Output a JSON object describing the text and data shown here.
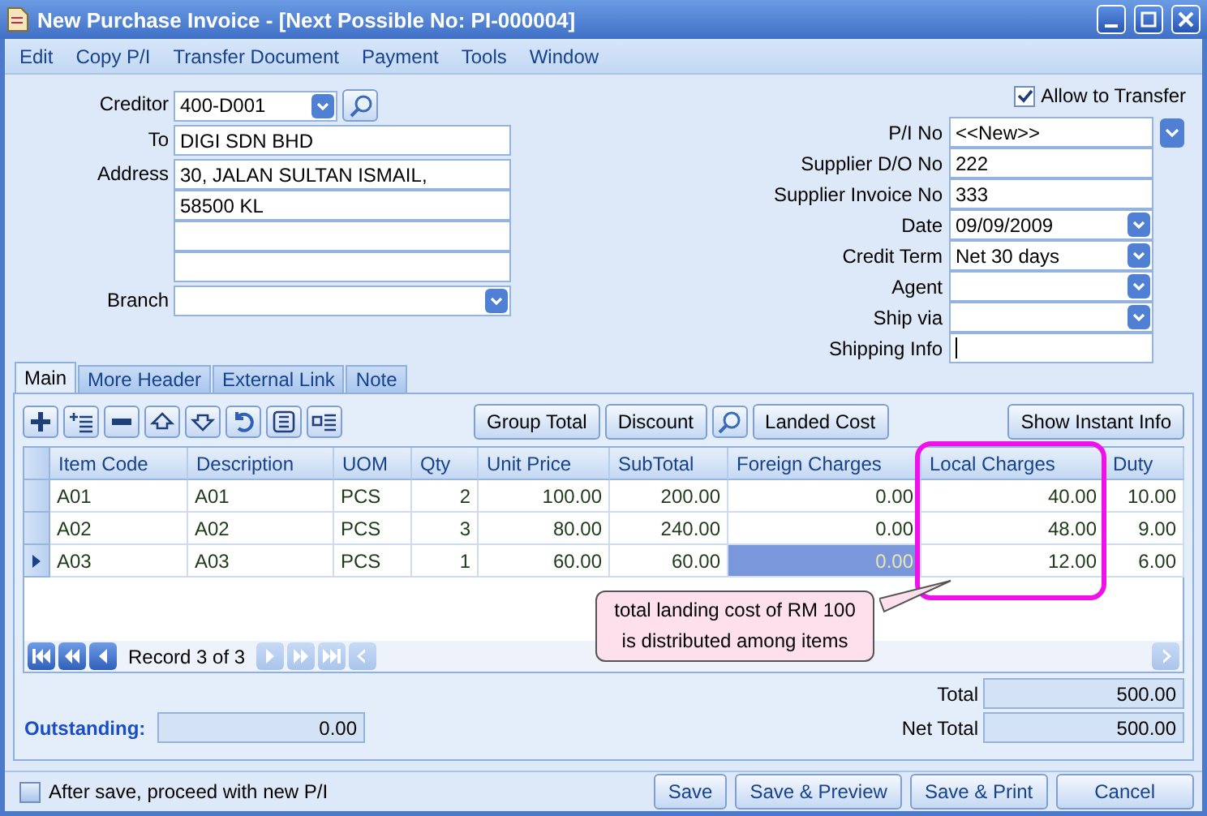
{
  "window": {
    "title": "New Purchase Invoice - [Next Possible No: PI-000004]"
  },
  "menu": [
    "Edit",
    "Copy P/I",
    "Transfer Document",
    "Payment",
    "Tools",
    "Window"
  ],
  "allow_to_transfer": {
    "label": "Allow to Transfer",
    "checked": true
  },
  "left_fields": [
    {
      "label": "Creditor",
      "kind": "combo-search",
      "value": "400-D001"
    },
    {
      "label": "To",
      "kind": "text",
      "value": "DIGI SDN BHD"
    },
    {
      "label": "Address",
      "kind": "lines",
      "lines": [
        "30, JALAN SULTAN ISMAIL,",
        "58500 KL"
      ]
    },
    {
      "label": "Branch",
      "kind": "combo"
    }
  ],
  "right_fields": [
    {
      "label": "P/I No",
      "kind": "combo-wide",
      "value": "<<New>>"
    },
    {
      "label": "Supplier D/O No",
      "kind": "text",
      "value": "222"
    },
    {
      "label": "Supplier Invoice No",
      "kind": "text",
      "value": "333"
    },
    {
      "label": "Date",
      "kind": "combo",
      "value": "09/09/2009"
    },
    {
      "label": "Credit Term",
      "kind": "combo",
      "value": "Net 30 days"
    },
    {
      "label": "Agent",
      "kind": "combo"
    },
    {
      "label": "Ship via",
      "kind": "combo"
    },
    {
      "label": "Shipping Info",
      "kind": "text",
      "focused": true
    }
  ],
  "tabs": [
    {
      "label": "Main",
      "selected": true
    },
    {
      "label": "More Header",
      "selected": false
    },
    {
      "label": "External Link",
      "selected": false
    },
    {
      "label": "Note",
      "selected": false
    }
  ],
  "toolbar": [
    {
      "kind": "text",
      "label": "Group Total"
    },
    {
      "kind": "text",
      "label": "Discount"
    },
    {
      "kind": "search"
    },
    {
      "kind": "text",
      "label": "Landed Cost"
    }
  ],
  "instant_info_button": "Show Instant Info",
  "table": {
    "columns": [
      "Item Code",
      "Description",
      "UOM",
      "Qty",
      "Unit Price",
      "SubTotal",
      "Foreign Charges",
      "Local Charges",
      "Duty"
    ],
    "rows": [
      {
        "selected": false,
        "cells": [
          "A01",
          "A01",
          "PCS",
          "2",
          "100.00",
          "200.00",
          "0.00",
          "40.00",
          "10.00"
        ]
      },
      {
        "selected": false,
        "cells": [
          "A02",
          "A02",
          "PCS",
          "3",
          "80.00",
          "240.00",
          "0.00",
          "48.00",
          "9.00"
        ]
      },
      {
        "selected": true,
        "cells": [
          "A03",
          "A03",
          "PCS",
          "1",
          "60.00",
          "60.00",
          "0.00",
          "12.00",
          "6.00"
        ]
      }
    ]
  },
  "navigator": {
    "record": "Record 3 of 3"
  },
  "callout": {
    "text": "total landing cost of RM 100 is distributed among items"
  },
  "totals": [
    {
      "label": "Total",
      "value": "500.00"
    },
    {
      "label": "Net Total",
      "value": "500.00"
    }
  ],
  "outstanding": {
    "label": "Outstanding:",
    "value": "0.00"
  },
  "proceed": {
    "label": "After save, proceed with new P/I",
    "checked": false
  },
  "actions": [
    "Save",
    "Save & Preview",
    "Save & Print",
    "Cancel"
  ]
}
